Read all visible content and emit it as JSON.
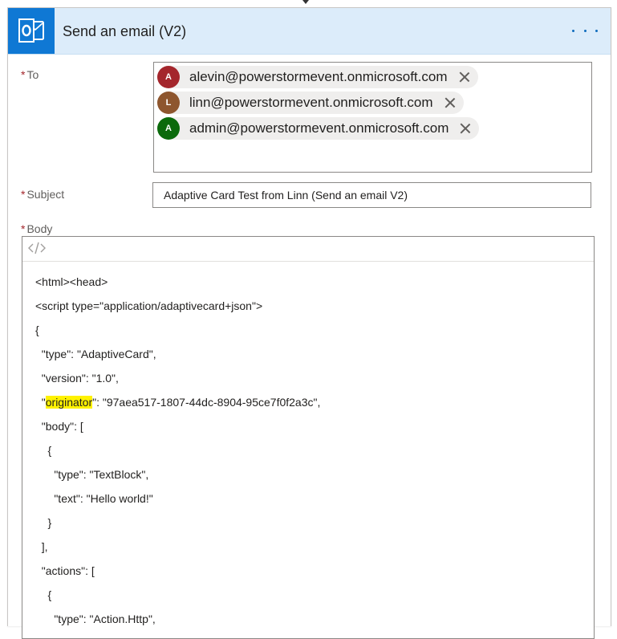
{
  "action": {
    "title": "Send an email (V2)",
    "icon": "outlook-icon",
    "menu_icon": "more-options-icon"
  },
  "to": {
    "label": "To",
    "recipients": [
      {
        "initial": "A",
        "email": "alevin@powerstormevent.onmicrosoft.com",
        "color": "#a4262c"
      },
      {
        "initial": "L",
        "email": "linn@powerstormevent.onmicrosoft.com",
        "color": "#8e562e"
      },
      {
        "initial": "A",
        "email": "admin@powerstormevent.onmicrosoft.com",
        "color": "#0b6a0b"
      }
    ]
  },
  "subject": {
    "label": "Subject",
    "value": "Adaptive Card Test from Linn (Send an email V2)"
  },
  "body": {
    "label": "Body",
    "code_toggle_icon": "code-view-icon",
    "lines": [
      {
        "text": "<html><head>"
      },
      {
        "text": "<script type=\"application/adaptivecard+json\">"
      },
      {
        "text": "{"
      },
      {
        "text": "  \"type\": \"AdaptiveCard\","
      },
      {
        "text": "  \"version\": \"1.0\","
      },
      {
        "before": "  \"",
        "highlight": "originator",
        "after": "\": \"97aea517-1807-44dc-8904-95ce7f0f2a3c\","
      },
      {
        "text": "  \"body\": ["
      },
      {
        "text": "    {"
      },
      {
        "text": "      \"type\": \"TextBlock\","
      },
      {
        "text": "      \"text\": \"Hello world!\""
      },
      {
        "text": "    }"
      },
      {
        "text": "  ],"
      },
      {
        "text": "  \"actions\": ["
      },
      {
        "text": "    {"
      },
      {
        "text": "      \"type\": \"Action.Http\","
      }
    ]
  },
  "colors": {
    "accent": "#0f78d4",
    "header_bg": "#dcecfa",
    "required": "#a4262c",
    "highlight": "#fff200"
  }
}
